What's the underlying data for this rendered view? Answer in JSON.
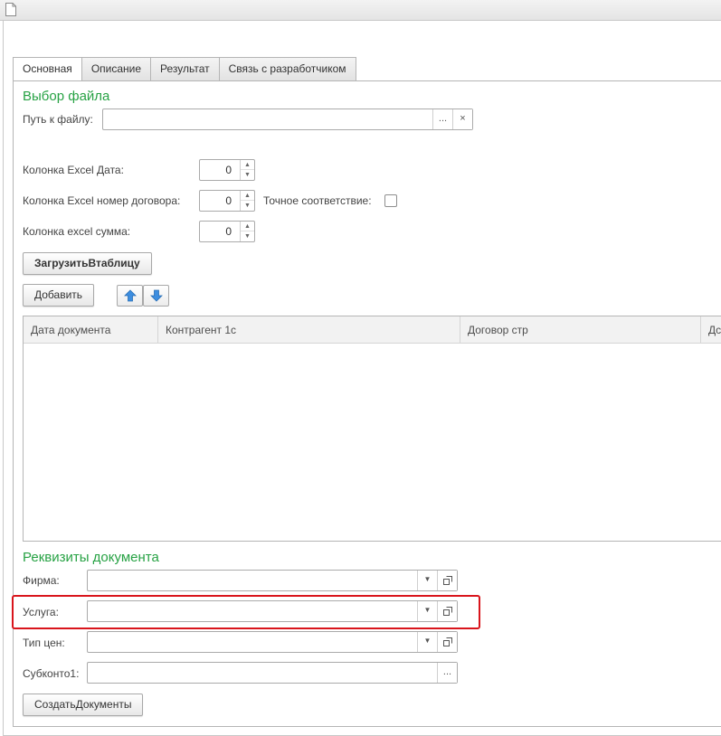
{
  "tabs": [
    {
      "label": "Основная",
      "active": true
    },
    {
      "label": "Описание",
      "active": false
    },
    {
      "label": "Результат",
      "active": false
    },
    {
      "label": "Связь с разработчиком",
      "active": false
    }
  ],
  "file_section": {
    "title": "Выбор файла",
    "path_label": "Путь к файлу:",
    "path_value": "",
    "browse_glyph": "...",
    "clear_glyph": "×"
  },
  "columns": {
    "date_label": "Колонка Excel Дата:",
    "date_value": "0",
    "contract_label": "Колонка Excel номер договора:",
    "contract_value": "0",
    "exact_label": "Точное соответствие:",
    "exact_checked": false,
    "sum_label": "Колонка excel сумма:",
    "sum_value": "0"
  },
  "buttons": {
    "load": "ЗагрузитьВтаблицу",
    "add": "Добавить",
    "create": "СоздатьДокументы"
  },
  "table": {
    "headers": [
      "Дата документа",
      "Контрагент 1с",
      "Договор стр",
      "Дс"
    ],
    "rows": []
  },
  "requisites": {
    "title": "Реквизиты документа",
    "firm_label": "Фирма:",
    "firm_value": "",
    "service_label": "Услуга:",
    "service_value": "",
    "price_type_label": "Тип цен:",
    "price_type_value": "",
    "subconto_label": "Субконто1:",
    "subconto_value": "",
    "select_glyph": "..."
  },
  "colors": {
    "section_title": "#27a244",
    "highlight": "#d9151c",
    "arrow_blue": "#3d8ee0"
  },
  "icons": [
    "document-icon",
    "arrow-up-icon",
    "arrow-down-icon",
    "dropdown-arrow-icon",
    "open-form-icon",
    "spin-up-icon",
    "spin-down-icon"
  ]
}
